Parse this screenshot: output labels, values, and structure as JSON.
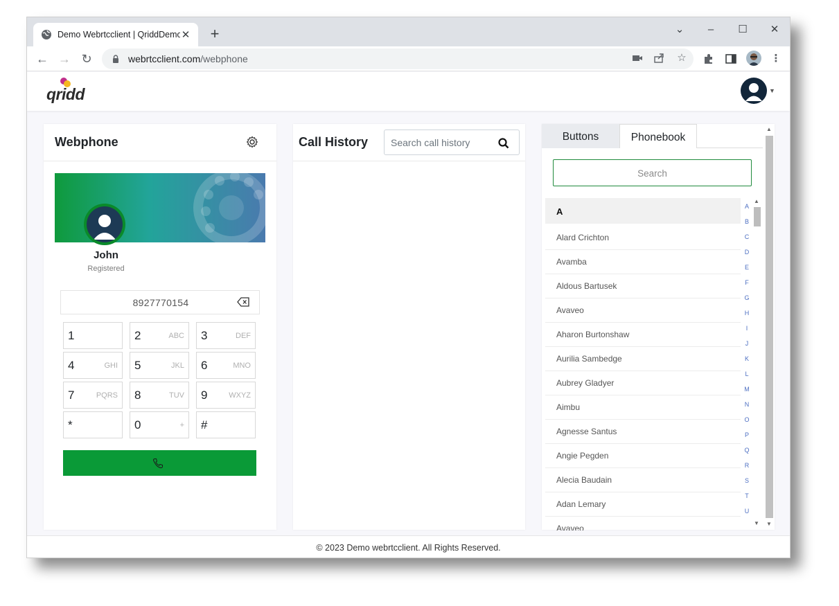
{
  "browser": {
    "tab_title": "Demo Webrtcclient | QriddDemo",
    "url_host": "webrtcclient.com",
    "url_path": "/webphone"
  },
  "app": {
    "logo_text": "qridd"
  },
  "webphone": {
    "title": "Webphone",
    "user_name": "John",
    "user_status": "Registered",
    "dialed_number": "8927770154",
    "keys": [
      {
        "digit": "1",
        "letters": ""
      },
      {
        "digit": "2",
        "letters": "ABC"
      },
      {
        "digit": "3",
        "letters": "DEF"
      },
      {
        "digit": "4",
        "letters": "GHI"
      },
      {
        "digit": "5",
        "letters": "JKL"
      },
      {
        "digit": "6",
        "letters": "MNO"
      },
      {
        "digit": "7",
        "letters": "PQRS"
      },
      {
        "digit": "8",
        "letters": "TUV"
      },
      {
        "digit": "9",
        "letters": "WXYZ"
      },
      {
        "digit": "*",
        "letters": ""
      },
      {
        "digit": "0",
        "letters": "+"
      },
      {
        "digit": "#",
        "letters": ""
      }
    ],
    "call_button_color": "#0a9a37"
  },
  "call_history": {
    "title": "Call History",
    "search_placeholder": "Search call history"
  },
  "phonebook": {
    "tabs": [
      "Buttons",
      "Phonebook"
    ],
    "active_tab": "Phonebook",
    "search_placeholder": "Search",
    "group_letter": "A",
    "contacts": [
      "Alard Crichton",
      "Avamba",
      "Aldous Bartusek",
      "Avaveo",
      "Aharon Burtonshaw",
      "Aurilia Sambedge",
      "Aubrey Gladyer",
      "Aimbu",
      "Agnesse Santus",
      "Angie Pegden",
      "Alecia Baudain",
      "Adan Lemary",
      "Avaveo"
    ],
    "alphabet": [
      "A",
      "B",
      "C",
      "D",
      "E",
      "F",
      "G",
      "H",
      "I",
      "J",
      "K",
      "L",
      "M",
      "N",
      "O",
      "P",
      "Q",
      "R",
      "S",
      "T",
      "U"
    ]
  },
  "footer": {
    "text": "© 2023 Demo webrtcclient. All Rights Reserved."
  }
}
